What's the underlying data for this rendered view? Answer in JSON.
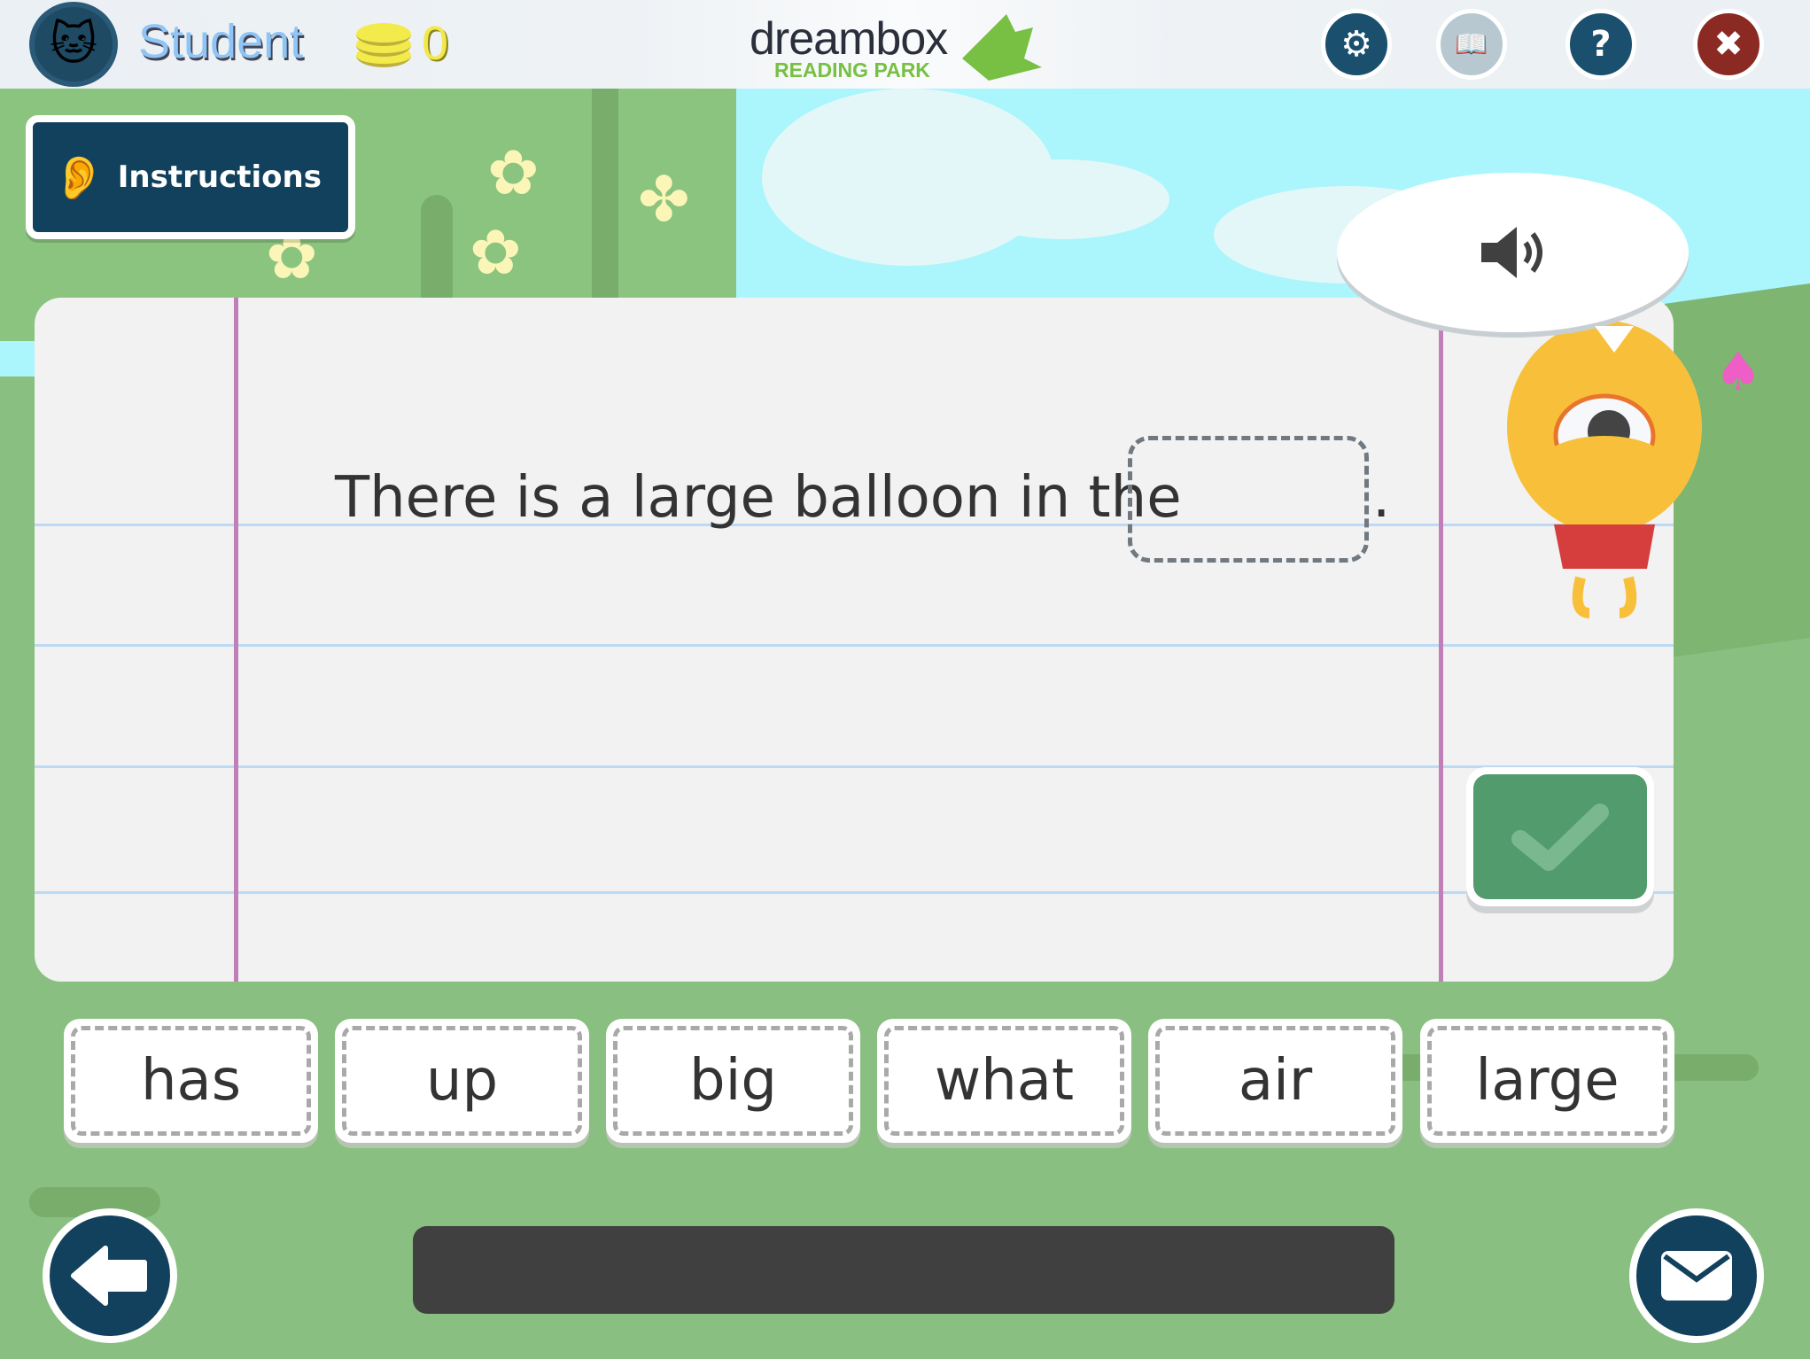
{
  "header": {
    "username": "Student",
    "coins": "0",
    "logo_word": "dreambox",
    "logo_sub": "READING PARK",
    "buttons": [
      {
        "name": "settings",
        "icon": "gear-icon",
        "color": "#1a4f6e"
      },
      {
        "name": "book",
        "icon": "book-icon",
        "color": "#b7c8d1"
      },
      {
        "name": "help",
        "icon": "question-icon",
        "color": "#1a4f6e"
      },
      {
        "name": "close",
        "icon": "close-icon",
        "color": "#8a2a22"
      }
    ]
  },
  "instructions": {
    "label": "Instructions",
    "icon": "ear-icon"
  },
  "activity": {
    "sentence": "There is a large balloon in the",
    "blank": "",
    "period": ".",
    "audio_icon": "speaker-icon",
    "check_icon": "checkmark-icon"
  },
  "word_choices": [
    "has",
    "up",
    "big",
    "what",
    "air",
    "large"
  ],
  "footer": {
    "back_icon": "back-arrow-icon",
    "mail_icon": "envelope-icon"
  },
  "colors": {
    "brand": "#12415e",
    "paper": "#f2f2f2",
    "check": "#529b6c",
    "grass": "#89bf80",
    "sky": "#aaf6fc"
  }
}
